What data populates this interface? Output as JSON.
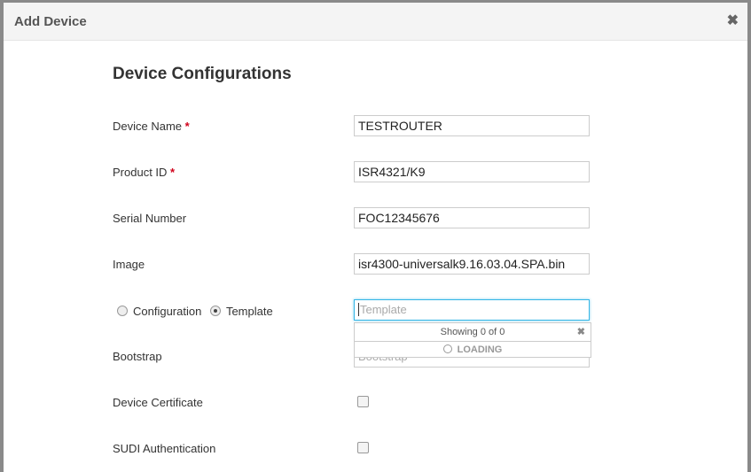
{
  "modal": {
    "title": "Add Device",
    "close_icon": "close-icon",
    "section_title": "Device Configurations",
    "fields": {
      "device_name": {
        "label": "Device Name",
        "required": "*",
        "value": "TESTROUTER"
      },
      "product_id": {
        "label": "Product ID",
        "required": "*",
        "value": "ISR4321/K9"
      },
      "serial_number": {
        "label": "Serial Number",
        "value": "FOC12345676"
      },
      "image": {
        "label": "Image",
        "value": "isr4300-universalk9.16.03.04.SPA.bin"
      },
      "config_type": {
        "option_configuration": "Configuration",
        "option_template": "Template",
        "selected": "Template"
      },
      "template": {
        "placeholder": "Template",
        "value": ""
      },
      "bootstrap": {
        "label": "Bootstrap",
        "placeholder": "Bootstrap"
      },
      "device_certificate": {
        "label": "Device Certificate",
        "checked": false
      },
      "sudi_authentication": {
        "label": "SUDI Authentication",
        "checked": false
      }
    },
    "dropdown": {
      "status": "Showing 0 of 0",
      "loading": "LOADING"
    }
  }
}
